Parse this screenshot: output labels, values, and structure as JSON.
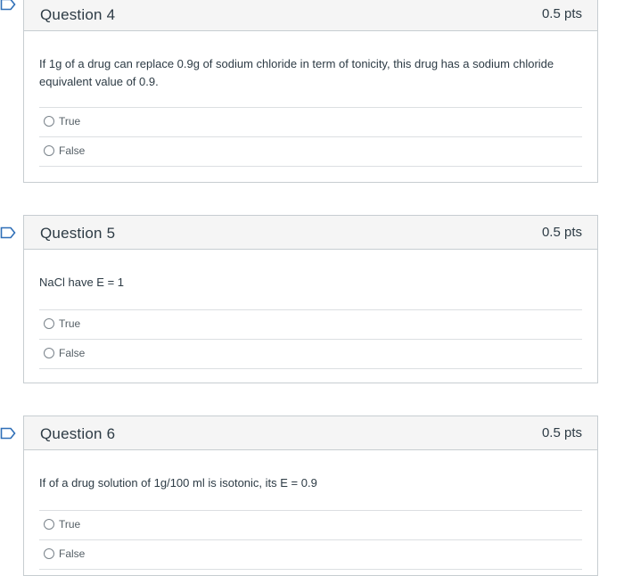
{
  "questions": [
    {
      "title": "Question 4",
      "points": "0.5 pts",
      "text": "If 1g of a drug can replace 0.9g of sodium chloride in term of tonicity, this drug has a sodium chloride equivalent value of 0.9.",
      "answers": [
        "True",
        "False"
      ]
    },
    {
      "title": "Question 5",
      "points": "0.5 pts",
      "text": "NaCl have E = 1",
      "answers": [
        "True",
        "False"
      ]
    },
    {
      "title": "Question 6",
      "points": "0.5 pts",
      "text": "If of a drug solution of 1g/100 ml is isotonic, its E = 0.9",
      "answers": [
        "True",
        "False"
      ]
    }
  ],
  "colors": {
    "flag_outline": "#2f6fb7",
    "header_bg": "#f5f5f5",
    "border": "#c7cdd1"
  },
  "icons": {
    "flag": "bookmark-flag-icon",
    "radio": "radio-circle-icon"
  }
}
